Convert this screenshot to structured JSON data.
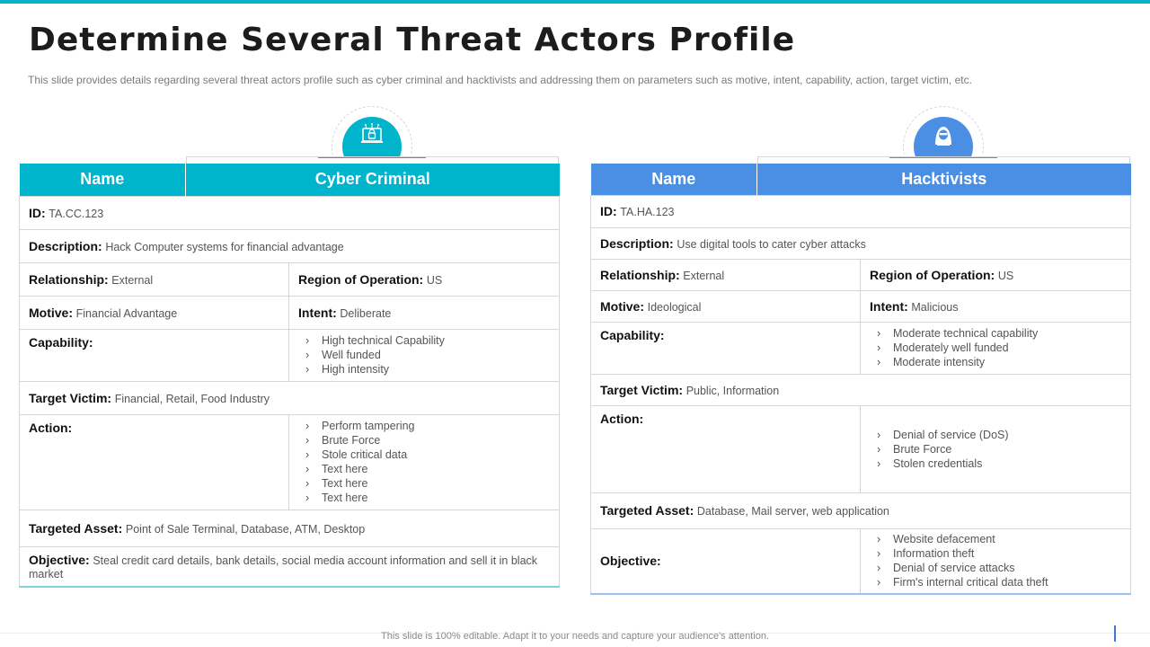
{
  "slide": {
    "title": "Determine Several Threat Actors Profile",
    "subtitle": "This slide provides  details regarding  several  threat actors profile  such as cyber criminal  and hacktivists  and addressing  them on parameters  such as motive,  intent, capability, action, target victim, etc.",
    "footer": "This slide is 100% editable. Adapt it to your needs and capture your audience's attention."
  },
  "colors": {
    "accent_left": "#00b4cc",
    "accent_right": "#4a8fe3",
    "top_bar": "#0ab4c8"
  },
  "icons": {
    "left": "cyber-criminal-laptop-icon",
    "right": "hacker-hood-icon"
  },
  "left": {
    "header_name": "Name",
    "header_value": "Cyber Criminal",
    "id_label": "ID:",
    "id_value": "TA.CC.123",
    "description_label": "Description:",
    "description_value": "Hack Computer  systems for financial advantage",
    "relationship_label": "Relationship:",
    "relationship_value": "External",
    "region_label": "Region of Operation:",
    "region_value": "US",
    "motive_label": "Motive:",
    "motive_value": "Financial Advantage",
    "intent_label": "Intent:",
    "intent_value": "Deliberate",
    "capability_label": "Capability:",
    "capability_items": [
      "High technical Capability",
      "Well funded",
      "High intensity"
    ],
    "target_label": "Target Victim:",
    "target_value": "Financial,  Retail,  Food Industry",
    "action_label": "Action:",
    "action_items": [
      "Perform tampering",
      "Brute Force",
      "Stole critical data",
      "Text here",
      "Text here",
      "Text here"
    ],
    "asset_label": "Targeted Asset:",
    "asset_value": "Point of Sale Terminal,  Database,  ATM, Desktop",
    "objective_label": "Objective:",
    "objective_value": "Steal credit card details,  bank details,  social media  account information  and sell it in black market"
  },
  "right": {
    "header_name": "Name",
    "header_value": "Hacktivists",
    "id_label": "ID:",
    "id_value": "TA.HA.123",
    "description_label": "Description:",
    "description_value": "Use digital tools to cater cyber attacks",
    "relationship_label": "Relationship:",
    "relationship_value": "External",
    "region_label": "Region of Operation:",
    "region_value": "US",
    "motive_label": "Motive:",
    "motive_value": "Ideological",
    "intent_label": "Intent:",
    "intent_value": "Malicious",
    "capability_label": "Capability:",
    "capability_items": [
      "Moderate  technical capability",
      "Moderately well funded",
      "Moderate  intensity"
    ],
    "target_label": "Target Victim:",
    "target_value": "Public, Information",
    "action_label": "Action:",
    "action_items": [
      "Denial of service  (DoS)",
      "Brute Force",
      "Stolen credentials"
    ],
    "asset_label": "Targeted Asset:",
    "asset_value": "Database,  Mail server,  web application",
    "objective_label": "Objective:",
    "objective_items": [
      "Website defacement",
      "Information  theft",
      "Denial of service  attacks",
      "Firm's internal critical data theft"
    ]
  }
}
